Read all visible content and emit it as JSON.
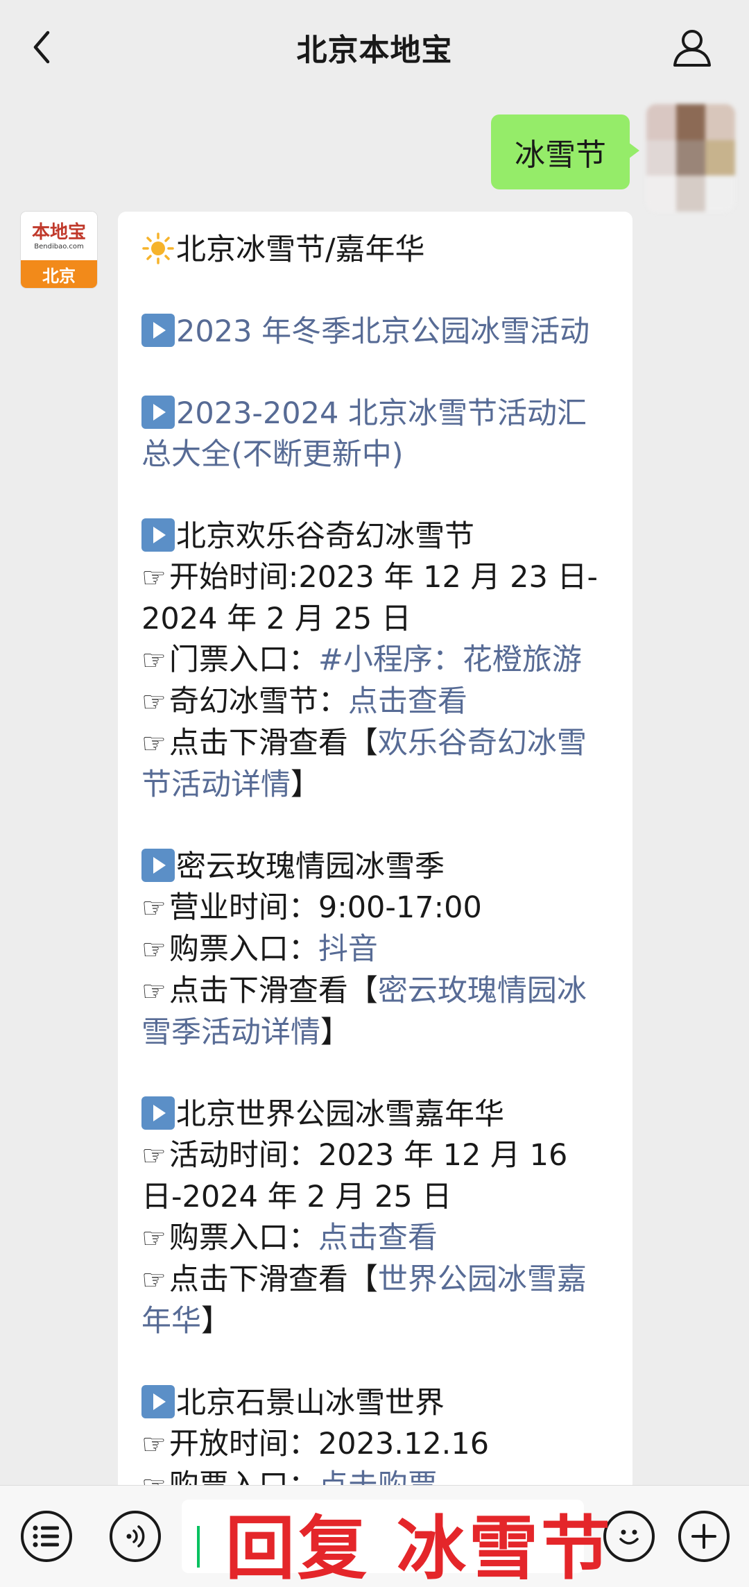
{
  "header": {
    "title": "北京本地宝"
  },
  "outgoing": {
    "text": "冰雪节"
  },
  "logo": {
    "brand": "本地宝",
    "domain": "Bendibao.com",
    "city": "北京"
  },
  "message": {
    "title": "北京冰雪节/嘉年华",
    "l1": "2023 年冬季北京公园冰雪活动",
    "l2": "2023-2024 北京冰雪节活动汇总大全(不断更新中)",
    "s1": {
      "name": "北京欢乐谷奇幻冰雪节",
      "time": "开始时间:2023 年 12 月 23 日-2024 年 2 月 25 日",
      "ticket_label": "门票入口：",
      "ticket_link": "#小程序：花橙旅游",
      "magic_label": "奇幻冰雪节：",
      "magic_link": "点击查看",
      "detail_pre": "点击下滑查看【",
      "detail_link": "欢乐谷奇幻冰雪节活动详情",
      "detail_post": "】"
    },
    "s2": {
      "name": "密云玫瑰情园冰雪季",
      "hours": "营业时间：9:00-17:00",
      "ticket_label": "购票入口：",
      "ticket_link": "抖音",
      "detail_pre": "点击下滑查看【",
      "detail_link": "密云玫瑰情园冰雪季活动详情",
      "detail_post": "】"
    },
    "s3": {
      "name": "北京世界公园冰雪嘉年华",
      "time": "活动时间：2023 年 12 月 16 日-2024 年 2 月 25 日",
      "ticket_label": "购票入口：",
      "ticket_link": "点击查看",
      "detail_pre": "点击下滑查看【",
      "detail_link": "世界公园冰雪嘉年华",
      "detail_post": "】"
    },
    "s4": {
      "name": "北京石景山冰雪世界",
      "time": "开放时间：2023.12.16",
      "ticket_label": "购票入口：",
      "ticket_link": "点击购票"
    }
  },
  "overlay": {
    "text": "回复 冰雪节"
  },
  "colors": {
    "green": "#95ec69",
    "link": "#576b95",
    "overlay_red": "#e4262a"
  }
}
